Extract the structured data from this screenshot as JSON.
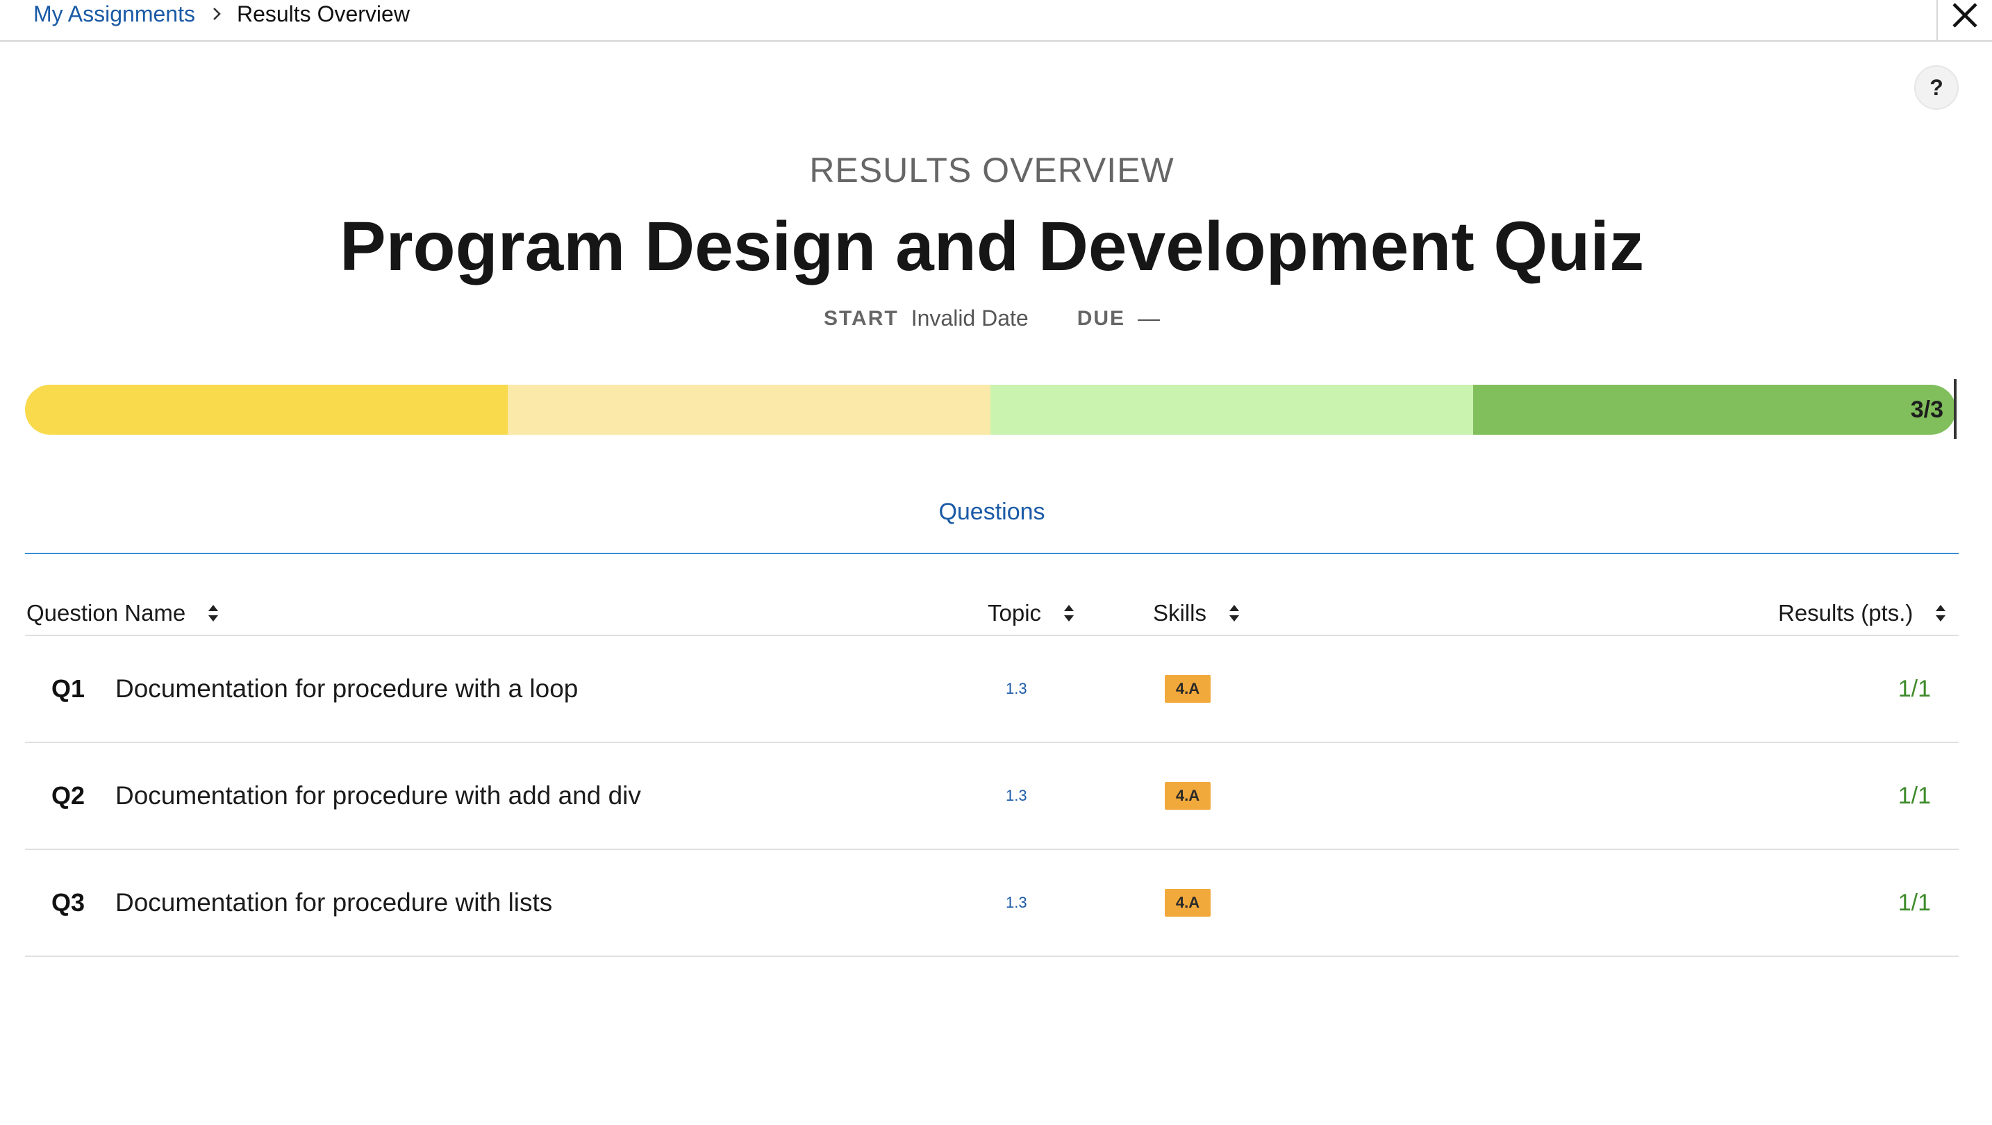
{
  "breadcrumb": {
    "parent": "My Assignments",
    "current": "Results Overview"
  },
  "header": {
    "eyebrow": "RESULTS OVERVIEW",
    "title": "Program Design and Development Quiz",
    "start_label": "START",
    "start_value": "Invalid Date",
    "due_label": "DUE",
    "due_value": "—"
  },
  "help": {
    "label": "?"
  },
  "progress": {
    "label": "3/3",
    "segments": [
      {
        "color": "#f8da4c",
        "fraction": 0.25
      },
      {
        "color": "#fae9a8",
        "fraction": 0.25
      },
      {
        "color": "#caf3b0",
        "fraction": 0.25
      },
      {
        "color": "#80bf5c",
        "fraction": 0.25
      }
    ]
  },
  "tabs": [
    {
      "label": "Questions",
      "active": true
    }
  ],
  "table": {
    "headers": {
      "name": "Question Name",
      "topic": "Topic",
      "skills": "Skills",
      "results": "Results (pts.)"
    },
    "rows": [
      {
        "num": "Q1",
        "name": "Documentation for procedure with a loop",
        "topic": "1.3",
        "skill": "4.A",
        "result": "1/1"
      },
      {
        "num": "Q2",
        "name": "Documentation for procedure with add and div",
        "topic": "1.3",
        "skill": "4.A",
        "result": "1/1"
      },
      {
        "num": "Q3",
        "name": "Documentation for procedure with lists",
        "topic": "1.3",
        "skill": "4.A",
        "result": "1/1"
      }
    ]
  },
  "icons": {
    "breadcrumb_separator": "chevron-right-icon",
    "close": "close-icon",
    "sort": "sort-icon"
  },
  "colors": {
    "link": "#1a5aa6",
    "skill_badge": "#f2a93b",
    "result_text": "#3d8a2a",
    "tab_underline": "#3a8ed4"
  }
}
